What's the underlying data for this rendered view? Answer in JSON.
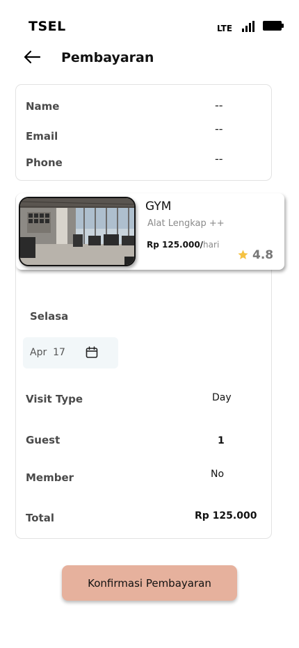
{
  "status_bar": {
    "carrier": "TSEL",
    "network": "LTE"
  },
  "header": {
    "title": "Pembayaran"
  },
  "user_info": {
    "rows": [
      {
        "label": "Name",
        "value": "--"
      },
      {
        "label": "Email",
        "value": "--"
      },
      {
        "label": "Phone",
        "value": "--"
      }
    ]
  },
  "venue": {
    "name": "GYM",
    "subtitle": "Alat Lengkap ++",
    "price": "Rp 125.000/",
    "price_unit": "hari",
    "rating": "4.8",
    "star_color": "#f5c242"
  },
  "booking": {
    "day": "Selasa",
    "date_month": "Apr",
    "date_day": "17",
    "rows": [
      {
        "label": "Visit Type",
        "value": "Day"
      },
      {
        "label": "Guest",
        "value": "1"
      },
      {
        "label": "Member",
        "value": "No"
      },
      {
        "label": "Total",
        "value": "Rp 125.000"
      }
    ]
  },
  "confirm": {
    "label": "Konfirmasi Pembayaran",
    "color": "#e6b19d"
  },
  "icons": {
    "back": "arrow-left-icon",
    "calendar": "calendar-icon",
    "star": "star-icon"
  }
}
